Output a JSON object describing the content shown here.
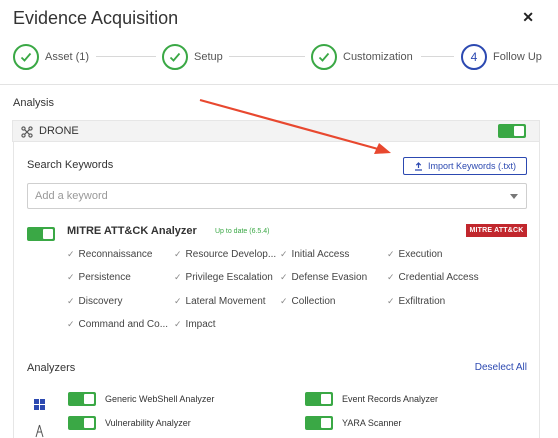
{
  "modal": {
    "title": "Evidence Acquisition"
  },
  "steps": [
    {
      "label": "Asset (1)",
      "done": true
    },
    {
      "label": "Setup",
      "done": true
    },
    {
      "label": "Customization",
      "done": true
    },
    {
      "label": "Follow Up",
      "done": false,
      "number": "4"
    }
  ],
  "analysis": {
    "section_title": "Analysis",
    "drone_label": "DRONE",
    "drone_enabled": true
  },
  "keywords": {
    "label": "Search Keywords",
    "import_label": "Import Keywords (.txt)",
    "placeholder": "Add a keyword"
  },
  "mitre": {
    "title": "MITRE ATT&CK Analyzer",
    "status": "Up to date (6.5.4)",
    "logo_text": "MITRE ATT&CK",
    "enabled": true,
    "tactics": [
      "Reconnaissance",
      "Resource Develop...",
      "Initial Access",
      "Execution",
      "Persistence",
      "Privilege Escalation",
      "Defense Evasion",
      "Credential Access",
      "Discovery",
      "Lateral Movement",
      "Collection",
      "Exfiltration",
      "Command and Co...",
      "Impact"
    ]
  },
  "analyzers": {
    "title": "Analyzers",
    "deselect_label": "Deselect All",
    "items": [
      {
        "label": "Generic WebShell Analyzer",
        "enabled": true
      },
      {
        "label": "Event Records Analyzer",
        "enabled": true
      },
      {
        "label": "Vulnerability Analyzer",
        "enabled": true
      },
      {
        "label": "YARA Scanner",
        "enabled": true
      }
    ]
  },
  "colors": {
    "accent": "#2c49b1",
    "success": "#3aa845",
    "mitre": "#c1272d",
    "annotation_arrow": "#e8482f"
  }
}
